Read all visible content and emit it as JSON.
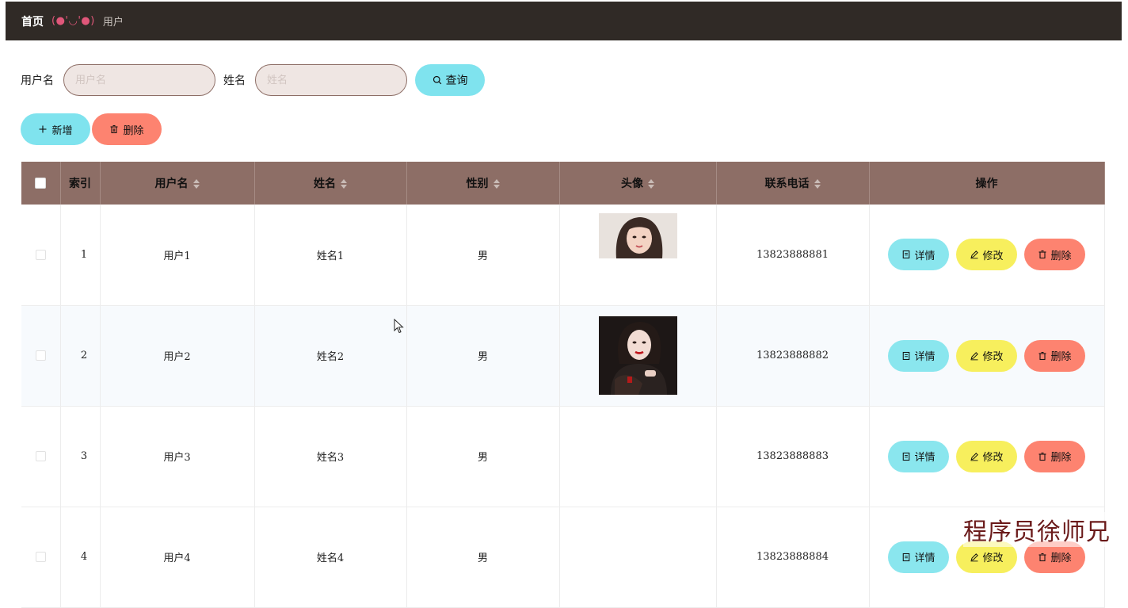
{
  "breadcrumb": {
    "home": "首页",
    "separator": "(●'◡'●)",
    "current": "用户"
  },
  "search": {
    "username_label": "用户名",
    "username_placeholder": "用户名",
    "username_value": "",
    "name_label": "姓名",
    "name_placeholder": "姓名",
    "name_value": "",
    "query_label": "查询"
  },
  "actions": {
    "add_label": "新增",
    "delete_label": "删除"
  },
  "table": {
    "columns": [
      "索引",
      "用户名",
      "姓名",
      "性别",
      "头像",
      "联系电话",
      "操作"
    ],
    "rows": [
      {
        "index": "1",
        "username": "用户1",
        "name": "姓名1",
        "gender": "男",
        "phone": "13823888881",
        "avatar": "photo-woman-light"
      },
      {
        "index": "2",
        "username": "用户2",
        "name": "姓名2",
        "gender": "男",
        "phone": "13823888882",
        "avatar": "photo-woman-dark"
      },
      {
        "index": "3",
        "username": "用户3",
        "name": "姓名3",
        "gender": "男",
        "phone": "13823888883",
        "avatar": ""
      },
      {
        "index": "4",
        "username": "用户4",
        "name": "姓名4",
        "gender": "男",
        "phone": "13823888884",
        "avatar": ""
      }
    ],
    "op_labels": {
      "detail": "详情",
      "edit": "修改",
      "delete": "删除"
    }
  },
  "colors": {
    "topbar": "#302a26",
    "header": "#8d6e66",
    "cyan": "#7fe3ee",
    "yellow": "#f7ef5d",
    "salmon": "#fd8370"
  },
  "watermark": "程序员徐师兄"
}
